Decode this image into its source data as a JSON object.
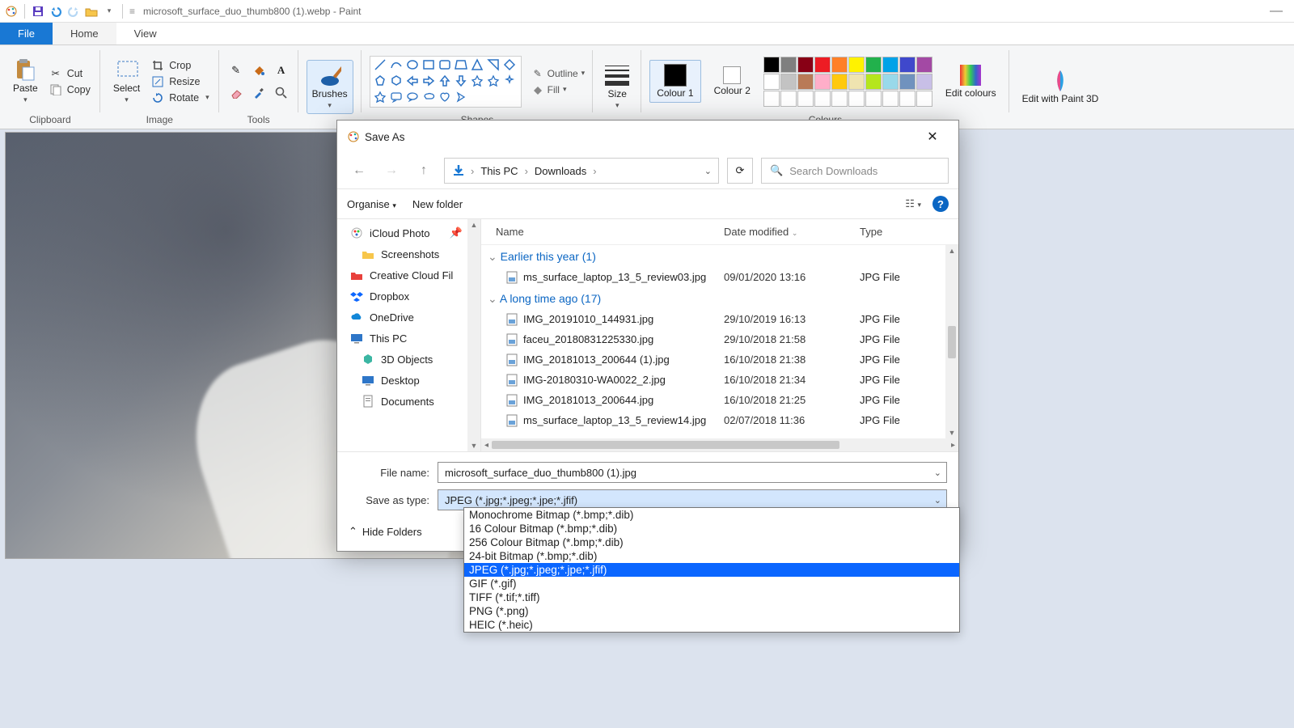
{
  "titlebar": {
    "title": "microsoft_surface_duo_thumb800 (1).webp - Paint",
    "minimize": "—"
  },
  "tabs": {
    "file": "File",
    "home": "Home",
    "view": "View"
  },
  "ribbon": {
    "clipboard": {
      "label": "Clipboard",
      "paste": "Paste",
      "cut": "Cut",
      "copy": "Copy"
    },
    "image": {
      "label": "Image",
      "select": "Select",
      "crop": "Crop",
      "resize": "Resize",
      "rotate": "Rotate"
    },
    "tools": {
      "label": "Tools"
    },
    "brushes": {
      "label": "Brushes"
    },
    "shapes": {
      "label": "Shapes",
      "outline": "Outline",
      "fill": "Fill"
    },
    "size": {
      "label": "Size"
    },
    "colours": {
      "label": "Colours",
      "c1": "Colour 1",
      "c2": "Colour 2",
      "edit": "Edit colours"
    },
    "paint3d": {
      "label": "Edit with Paint 3D"
    }
  },
  "swatches": {
    "row1": [
      "#000000",
      "#7f7f7f",
      "#880015",
      "#ed1c24",
      "#ff7f27",
      "#fff200",
      "#22b14c",
      "#00a2e8",
      "#3f48cc",
      "#a349a4"
    ],
    "row2": [
      "#ffffff",
      "#c3c3c3",
      "#b97a57",
      "#ffaec9",
      "#ffc90e",
      "#efe4b0",
      "#b5e61d",
      "#99d9ea",
      "#7092be",
      "#c8bfe7"
    ],
    "row3": [
      "#ffffff",
      "#ffffff",
      "#ffffff",
      "#ffffff",
      "#ffffff",
      "#ffffff",
      "#ffffff",
      "#ffffff",
      "#ffffff",
      "#ffffff"
    ]
  },
  "dialog": {
    "title": "Save As",
    "breadcrumb": {
      "root": "This PC",
      "folder": "Downloads"
    },
    "search_placeholder": "Search Downloads",
    "toolbar": {
      "organise": "Organise",
      "newfolder": "New folder"
    },
    "nav": {
      "items": [
        {
          "label": "iCloud Photo",
          "pinned": true,
          "sub": false,
          "icon": "icloud"
        },
        {
          "label": "Screenshots",
          "sub": true,
          "icon": "folder"
        },
        {
          "label": "Creative Cloud Fil",
          "sub": false,
          "icon": "cc"
        },
        {
          "label": "Dropbox",
          "sub": false,
          "icon": "dropbox"
        },
        {
          "label": "OneDrive",
          "sub": false,
          "icon": "onedrive"
        },
        {
          "label": "This PC",
          "sub": false,
          "icon": "thispc"
        },
        {
          "label": "3D Objects",
          "sub": true,
          "icon": "3d"
        },
        {
          "label": "Desktop",
          "sub": true,
          "icon": "desktop"
        },
        {
          "label": "Documents",
          "sub": true,
          "icon": "documents"
        }
      ]
    },
    "columns": {
      "name": "Name",
      "date": "Date modified",
      "type": "Type"
    },
    "groups": [
      {
        "header": "Earlier this year (1)",
        "rows": [
          {
            "name": "ms_surface_laptop_13_5_review03.jpg",
            "date": "09/01/2020 13:16",
            "type": "JPG File"
          }
        ]
      },
      {
        "header": "A long time ago (17)",
        "rows": [
          {
            "name": "IMG_20191010_144931.jpg",
            "date": "29/10/2019 16:13",
            "type": "JPG File"
          },
          {
            "name": "faceu_20180831225330.jpg",
            "date": "29/10/2018 21:58",
            "type": "JPG File"
          },
          {
            "name": "IMG_20181013_200644 (1).jpg",
            "date": "16/10/2018 21:38",
            "type": "JPG File"
          },
          {
            "name": "IMG-20180310-WA0022_2.jpg",
            "date": "16/10/2018 21:34",
            "type": "JPG File"
          },
          {
            "name": "IMG_20181013_200644.jpg",
            "date": "16/10/2018 21:25",
            "type": "JPG File"
          },
          {
            "name": "ms_surface_laptop_13_5_review14.jpg",
            "date": "02/07/2018 11:36",
            "type": "JPG File"
          }
        ]
      }
    ],
    "fields": {
      "filename_label": "File name:",
      "filename_value": "microsoft_surface_duo_thumb800 (1).jpg",
      "type_label": "Save as type:",
      "type_value": "JPEG (*.jpg;*.jpeg;*.jpe;*.jfif)"
    },
    "type_options": [
      "Monochrome Bitmap (*.bmp;*.dib)",
      "16 Colour Bitmap (*.bmp;*.dib)",
      "256 Colour Bitmap (*.bmp;*.dib)",
      "24-bit Bitmap (*.bmp;*.dib)",
      "JPEG (*.jpg;*.jpeg;*.jpe;*.jfif)",
      "GIF (*.gif)",
      "TIFF (*.tif;*.tiff)",
      "PNG (*.png)",
      "HEIC (*.heic)"
    ],
    "type_selected_index": 4,
    "footer": {
      "hide": "Hide Folders"
    }
  }
}
